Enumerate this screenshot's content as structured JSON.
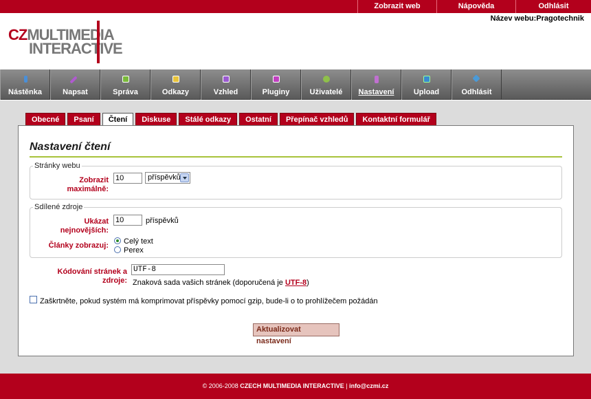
{
  "top_links": [
    "Zobrazit web",
    "Nápověda",
    "Odhlásit"
  ],
  "site_name": "Název webu:Pragotechnik",
  "logo": {
    "cz": "CZ",
    "line1": "MULTIMEDIA",
    "line2": "INTERACTIVE"
  },
  "nav": [
    {
      "label": "Nástěnka",
      "icon": "pin-icon",
      "color": "#4a8fd8"
    },
    {
      "label": "Napsat",
      "icon": "pencil-icon",
      "color": "#b05ad0"
    },
    {
      "label": "Správa",
      "icon": "edit-icon",
      "color": "#7ab93a"
    },
    {
      "label": "Odkazy",
      "icon": "link-icon",
      "color": "#e8c33a"
    },
    {
      "label": "Vzhled",
      "icon": "theme-icon",
      "color": "#9a5ad0"
    },
    {
      "label": "Pluginy",
      "icon": "plugin-icon",
      "color": "#c040c0"
    },
    {
      "label": "Uživatelé",
      "icon": "users-icon",
      "color": "#8fc04a"
    },
    {
      "label": "Nastavení",
      "icon": "settings-icon",
      "color": "#c070d0"
    },
    {
      "label": "Upload",
      "icon": "upload-icon",
      "color": "#3a8ad0"
    },
    {
      "label": "Odhlásit",
      "icon": "logout-icon",
      "color": "#4a9ad8"
    }
  ],
  "tabs": [
    "Obecné",
    "Psaní",
    "Čtení",
    "Diskuse",
    "Stálé odkazy",
    "Ostatní",
    "Přepínač vzhledů",
    "Kontaktní formulář"
  ],
  "active_tab": "Čtení",
  "page_title": "Nastavení čtení",
  "fieldset1": {
    "legend": "Stránky webu",
    "label": "Zobrazit maximálně:",
    "value": "10",
    "select": "příspěvků"
  },
  "fieldset2": {
    "legend": "Sdílené zdroje",
    "label_newest": "Ukázat nejnovějších:",
    "value": "10",
    "unit": "příspěvků",
    "label_show": "Články zobrazuj:",
    "option_full": "Celý text",
    "option_perex": "Perex"
  },
  "encoding": {
    "label": "Kódování stránek a zdroje:",
    "value": "UTF-8",
    "help_prefix": "Znaková sada vašich stránek (doporučená je",
    "help_link": "UTF-8",
    "help_suffix": ")"
  },
  "gzip_label": "Zaškrtněte, pokud systém má komprimovat příspěvky pomocí gzip, bude-li o to prohlížečem požádán",
  "submit_label": "Aktualizovat nastavení",
  "footer": {
    "prefix": "© 2006-2008",
    "company": "CZECH MULTIMEDIA INTERACTIVE",
    "sep": "|",
    "email": "info@czmi.cz"
  }
}
